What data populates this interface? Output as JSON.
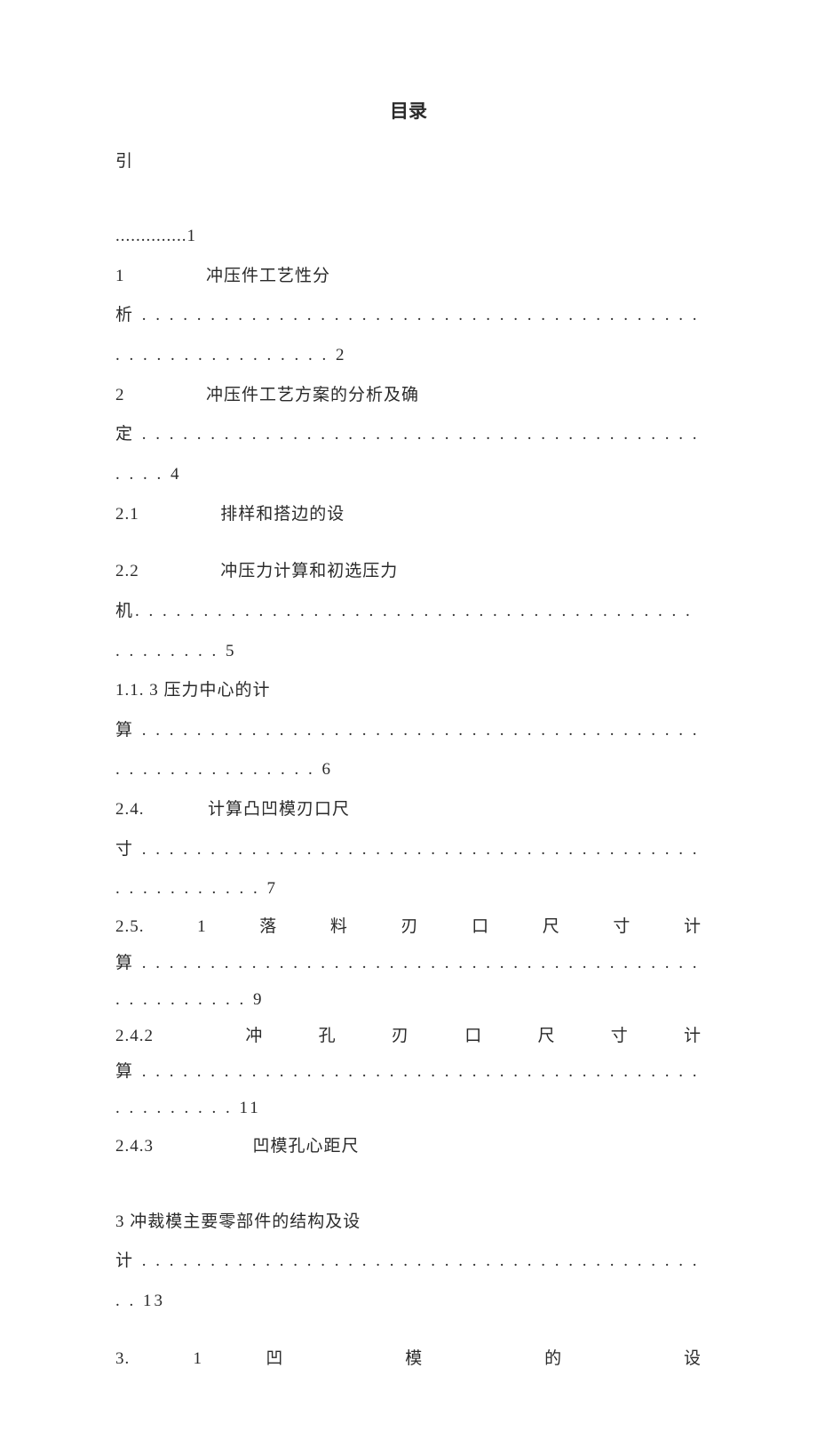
{
  "title": "目录",
  "toc": {
    "e0_l1": "引",
    "e0_l2": "..............1",
    "e1_l1_a": "1",
    "e1_l1_b": "冲压件工艺性分",
    "e1_l2": "析 . . . . . . . . . . . . . . . . . . . . . . . . . . . . . . . . . . . . . . . . . . . . . . . . . . . . . . . . . 2",
    "e2_l1_a": "2",
    "e2_l1_b": "冲压件工艺方案的分析及确",
    "e2_l2": "定 . . . . . . . . . . . . . . . . . . . . . . . . . . . . . . . . . . . . . . . . . . . . . 4",
    "e3_l1_a": "2.1",
    "e3_l1_b": "排样和搭边的设",
    "e4_l1_a": "2.2",
    "e4_l1_b": "冲压力计算和初选压力",
    "e4_l2": "机. . . . . . . . . . . . . . . . . . . . . . . . . . . . . . . . . . . . . . . . . . . . . . . . . 5",
    "e5_l1": "1.1. 3 压力中心的计",
    "e5_l2": "算 . . . . . . . . . . . . . . . . . . . . . . . . . . . . . . . . . . . . . . . . . . . . . . . . . . . . . . . . 6",
    "e6_l1_a": "2.4.",
    "e6_l1_b": "计算凸凹模刃口尺",
    "e6_l2": "寸 . . . . . . . . . . . . . . . . . . . . . . . . . . . . . . . . . . . . . . . . . . . . . . . . . . . . 7",
    "e7_l1": "2.5.　1　落　料　刃　口　尺　寸　计",
    "e7_l2": "算 . . . . . . . . . . . . . . . . . . . . . . . . . . . . . . . . . . . . . . . . . . . . . . . . . . . 9",
    "e8_l1": "2.4.2　　冲　孔　刃　口　尺　寸　计",
    "e8_l2": "算 . . . . . . . . . . . . . . . . . . . . . . . . . . . . . . . . . . . . . . . . . . . . . . . . . . 11",
    "e9_l1_a": "2.4.3",
    "e9_l1_b": "凹模孔心距尺",
    "e10_l1": "3 冲裁模主要零部件的结构及设",
    "e10_l2": "计 . . . . . . . . . . . . . . . . . . . . . . . . . . . . . . . . . . . . . . . . . . . 13",
    "e11_l1": "3. 1             凹           模           的           设"
  }
}
